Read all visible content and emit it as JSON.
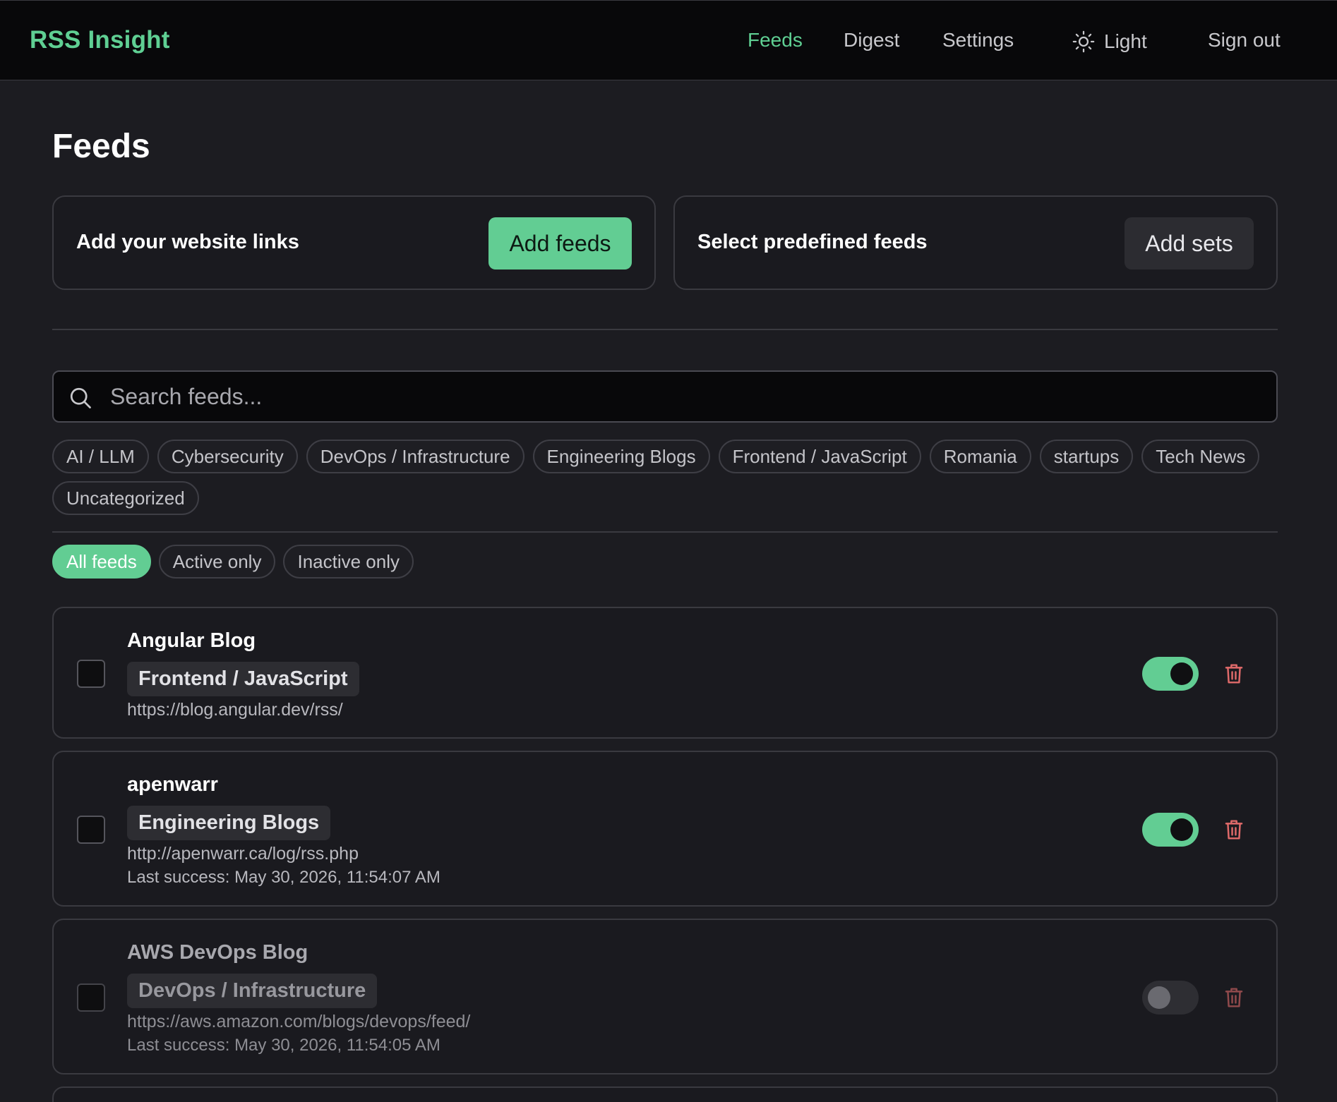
{
  "header": {
    "brand": "RSS Insight",
    "nav": {
      "feeds": "Feeds",
      "digest": "Digest",
      "settings": "Settings",
      "theme": "Light",
      "signout": "Sign out"
    },
    "accent_color": "#5fcf93"
  },
  "page": {
    "title": "Feeds"
  },
  "actions": {
    "add_links_text": "Add your website links",
    "add_feeds_label": "Add feeds",
    "predefined_text": "Select predefined feeds",
    "add_sets_label": "Add sets"
  },
  "search": {
    "placeholder": "Search feeds...",
    "value": ""
  },
  "tags": [
    "AI / LLM",
    "Cybersecurity",
    "DevOps / Infrastructure",
    "Engineering Blogs",
    "Frontend / JavaScript",
    "Romania",
    "startups",
    "Tech News",
    "Uncategorized"
  ],
  "filters": {
    "all": "All feeds",
    "active": "Active only",
    "inactive": "Inactive only",
    "selected": "All feeds"
  },
  "feeds": [
    {
      "name": "Angular Blog",
      "tag": "Frontend / JavaScript",
      "url": "https://blog.angular.dev/rss/",
      "last_success": "",
      "active": true,
      "checked": false
    },
    {
      "name": "apenwarr",
      "tag": "Engineering Blogs",
      "url": "http://apenwarr.ca/log/rss.php",
      "last_success": "Last success: May 30, 2026, 11:54:07 AM",
      "active": true,
      "checked": false
    },
    {
      "name": "AWS DevOps Blog",
      "tag": "DevOps / Infrastructure",
      "url": "https://aws.amazon.com/blogs/devops/feed/",
      "last_success": "Last success: May 30, 2026, 11:54:05 AM",
      "active": false,
      "checked": false
    }
  ],
  "icons": {
    "theme": "sun-icon",
    "search": "search-icon",
    "delete": "trash-icon"
  }
}
